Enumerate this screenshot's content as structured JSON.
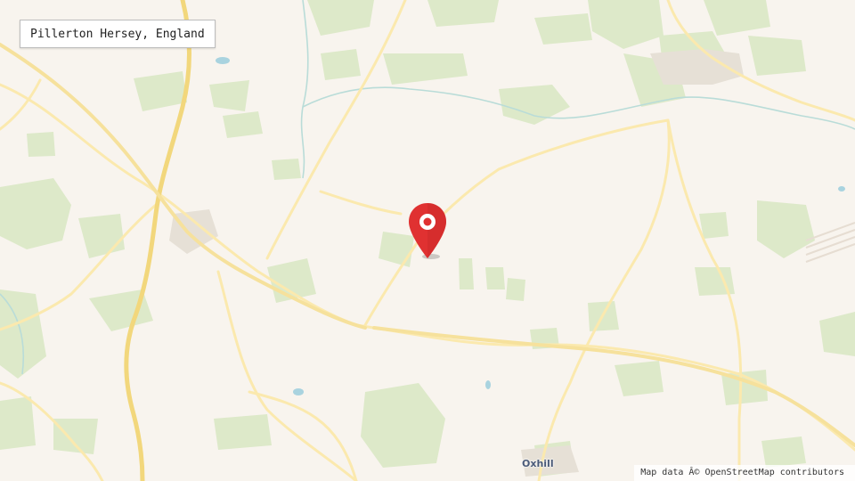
{
  "map": {
    "location_label": "Pillerton Hersey, England",
    "town_label": "Oxhill",
    "attribution": "Map data Â© OpenStreetMap contributors",
    "marker_icon": "map-pin-icon",
    "colors": {
      "background": "#f8f4ee",
      "woodland": "#dde9c9",
      "major_road": "#f2d77c",
      "minor_road": "#fbe9ae",
      "stream": "#b9dcd8",
      "water": "#a9d3df",
      "marker": "#e03131"
    }
  }
}
